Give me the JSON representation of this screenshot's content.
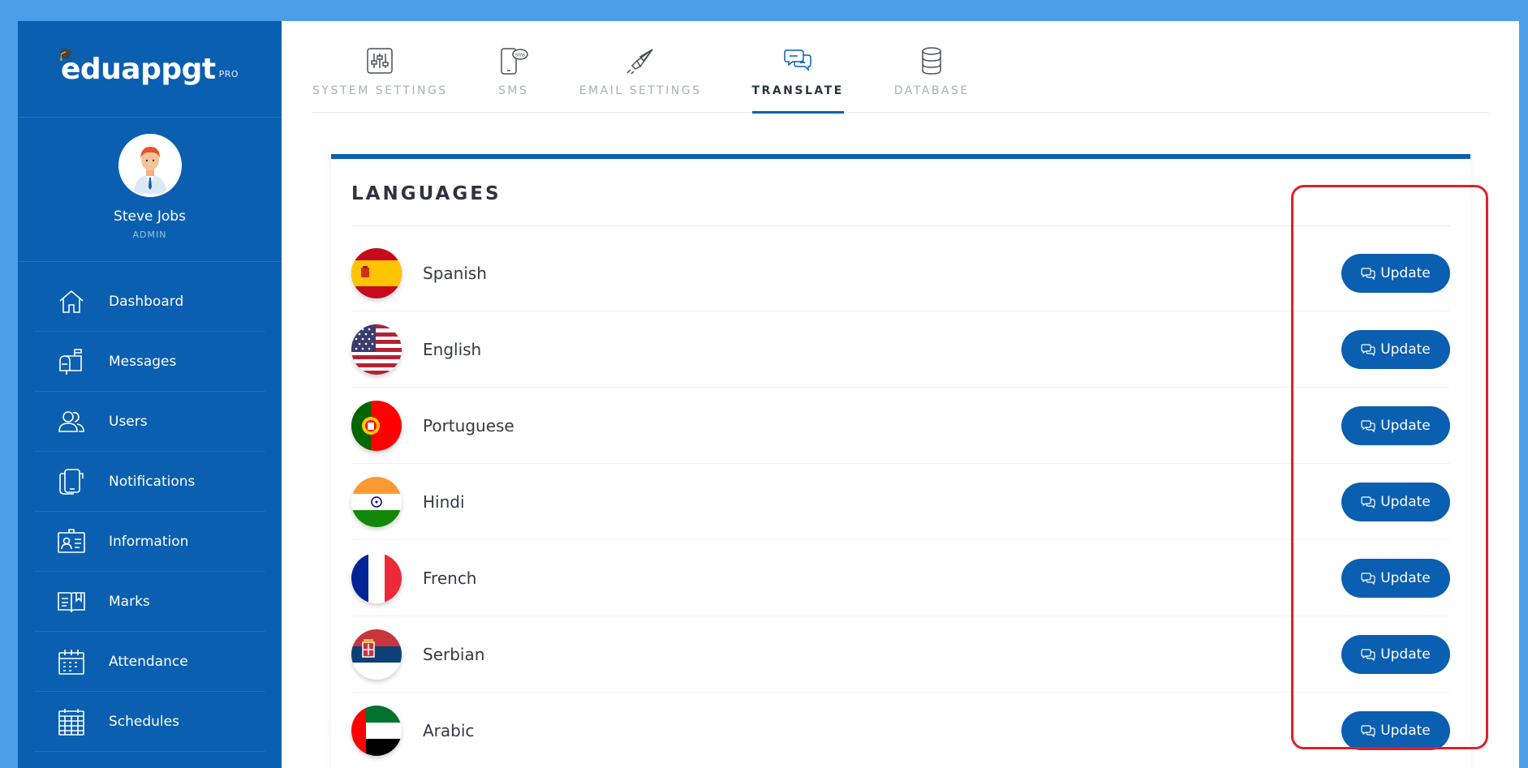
{
  "app": {
    "logo_text": "eduappgt",
    "logo_suffix": "PRO"
  },
  "profile": {
    "name": "Steve Jobs",
    "role": "ADMIN"
  },
  "sidebar": {
    "items": [
      {
        "label": "Dashboard",
        "icon": "home-icon"
      },
      {
        "label": "Messages",
        "icon": "mailbox-icon"
      },
      {
        "label": "Users",
        "icon": "users-icon"
      },
      {
        "label": "Notifications",
        "icon": "notifications-icon"
      },
      {
        "label": "Information",
        "icon": "id-card-icon"
      },
      {
        "label": "Marks",
        "icon": "book-icon"
      },
      {
        "label": "Attendance",
        "icon": "calendar-icon"
      },
      {
        "label": "Schedules",
        "icon": "schedule-grid-icon"
      }
    ]
  },
  "tabs": [
    {
      "label": "SYSTEM SETTINGS",
      "icon": "sliders-icon",
      "active": false
    },
    {
      "label": "SMS",
      "icon": "sms-phone-icon",
      "active": false
    },
    {
      "label": "EMAIL SETTINGS",
      "icon": "send-icon",
      "active": false
    },
    {
      "label": "TRANSLATE",
      "icon": "chat-bubbles-icon",
      "active": true
    },
    {
      "label": "DATABASE",
      "icon": "database-icon",
      "active": false
    }
  ],
  "languages": {
    "title": "LANGUAGES",
    "button_label": "Update",
    "items": [
      {
        "name": "Spanish",
        "flag": "spain-flag"
      },
      {
        "name": "English",
        "flag": "usa-flag"
      },
      {
        "name": "Portuguese",
        "flag": "portugal-flag"
      },
      {
        "name": "Hindi",
        "flag": "india-flag"
      },
      {
        "name": "French",
        "flag": "france-flag"
      },
      {
        "name": "Serbian",
        "flag": "serbia-flag"
      },
      {
        "name": "Arabic",
        "flag": "uae-flag"
      }
    ]
  },
  "colors": {
    "primary": "#0a5fb0",
    "page_background": "#4a9fe8",
    "highlight": "#e0202a"
  }
}
